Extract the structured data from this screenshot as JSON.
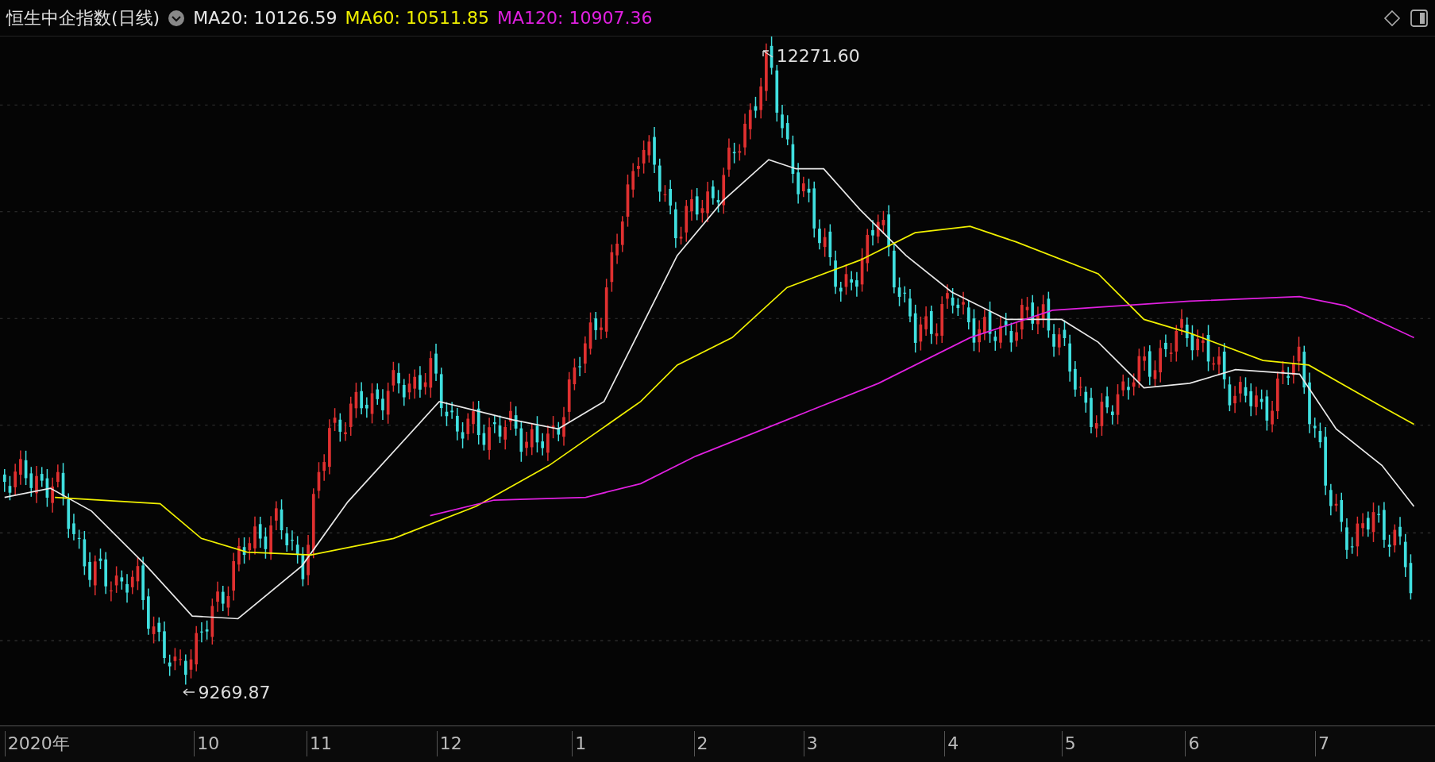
{
  "header": {
    "title": "恒生中企指数(日线)",
    "indicators": [
      {
        "label": "MA20:",
        "value": "10126.59",
        "color": "#e8e8e8"
      },
      {
        "label": "MA60:",
        "value": "10511.85",
        "color": "#f0f000"
      },
      {
        "label": "MA120:",
        "value": "10907.36",
        "color": "#e020e0"
      }
    ]
  },
  "chart": {
    "high_label": "12271.60",
    "low_label": "9269.87"
  },
  "x_axis": {
    "labels": [
      "2020年",
      "10",
      "11",
      "12",
      "1",
      "2",
      "3",
      "4",
      "5",
      "6",
      "7"
    ]
  }
}
